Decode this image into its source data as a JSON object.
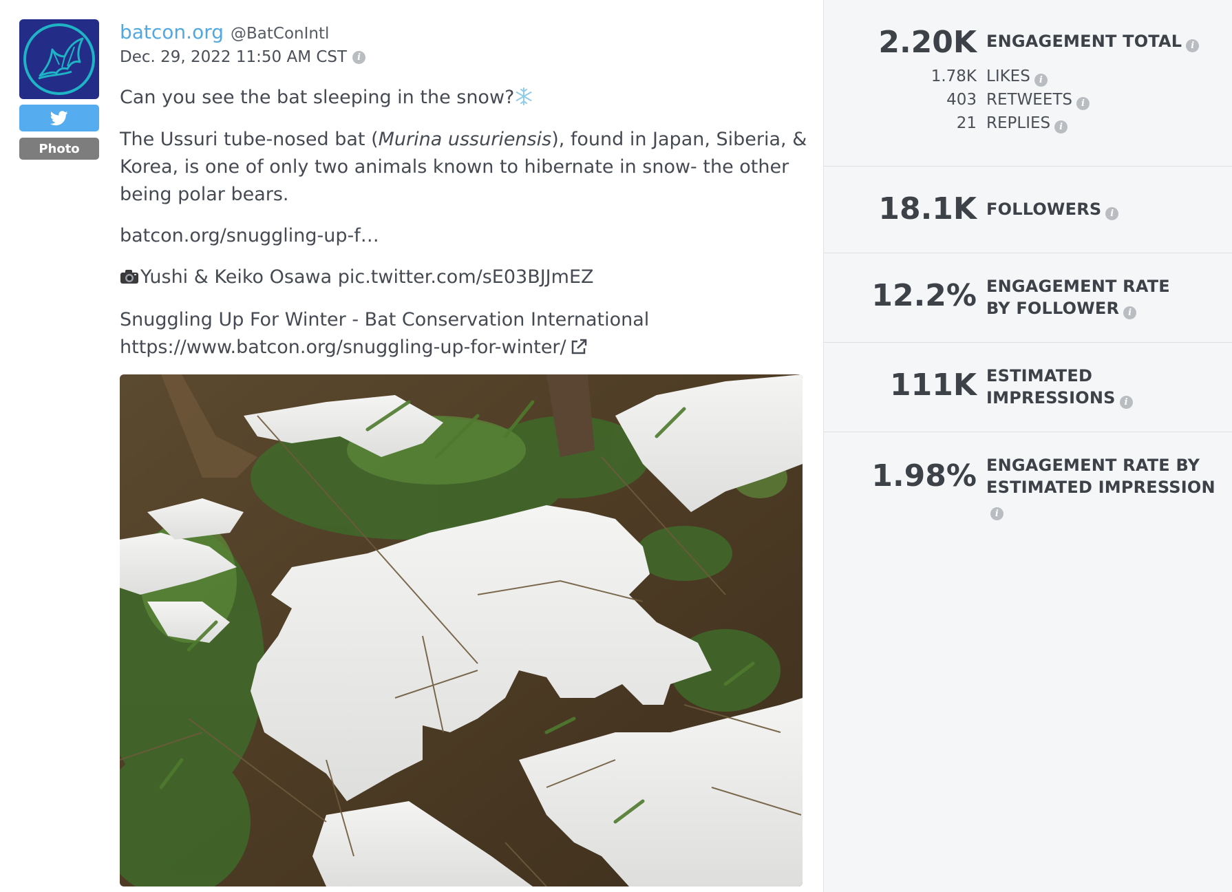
{
  "post": {
    "network_icon": "twitter-bird-icon",
    "type_badge": "Photo",
    "author_name": "batcon.org",
    "author_handle": "@BatConIntl",
    "date": "Dec. 29, 2022 11:50 AM CST",
    "line1": "Can you see the bat sleeping in the snow?",
    "p2_before": "The Ussuri tube-nosed bat (",
    "p2_italic": "Murina ussuriensis",
    "p2_after": "), found in Japan, Siberia, & Korea, is one of only two animals known to hibernate in snow- the other being polar bears.",
    "short_link": "batcon.org/snuggling-up-f…",
    "credit_text": "Yushi & Keiko Osawa pic.twitter.com/sE03BJJmEZ",
    "link_title": "Snuggling Up For Winter - Bat Conservation International",
    "link_url": "https://www.batcon.org/snuggling-up-for-winter/"
  },
  "metrics": {
    "engagement_total": {
      "value": "2.20K",
      "label": "ENGAGEMENT TOTAL"
    },
    "likes": {
      "value": "1.78K",
      "label": "LIKES"
    },
    "retweets": {
      "value": "403",
      "label": "RETWEETS"
    },
    "replies": {
      "value": "21",
      "label": "REPLIES"
    },
    "followers": {
      "value": "18.1K",
      "label": "FOLLOWERS"
    },
    "engagement_rate_follower": {
      "value": "12.2%",
      "label": "ENGAGEMENT RATE BY FOLLOWER"
    },
    "estimated_impressions": {
      "value": "111K",
      "label": "ESTIMATED IMPRESSIONS"
    },
    "engagement_rate_impression": {
      "value": "1.98%",
      "label": "ENGAGEMENT RATE BY ESTIMATED IMPRESSION"
    }
  },
  "colors": {
    "link_blue": "#52a8e0",
    "twitter_blue": "#55acee",
    "avatar_navy": "#232c86",
    "avatar_teal": "#1fb3c6",
    "panel_bg": "#f5f6f7"
  }
}
